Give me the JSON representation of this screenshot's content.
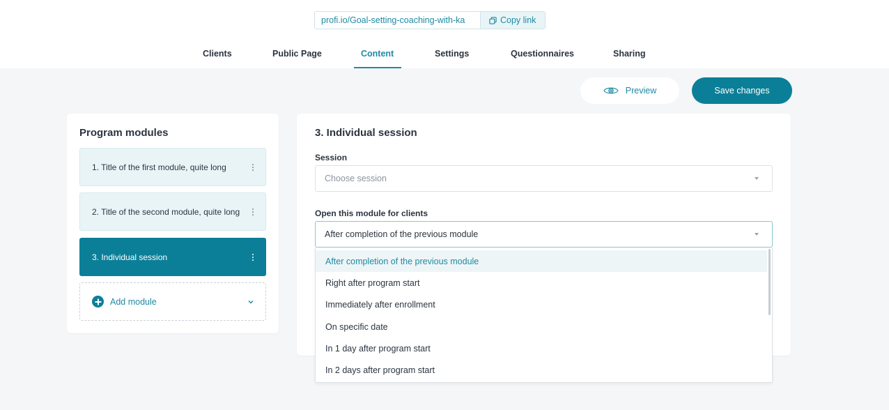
{
  "header": {
    "url": "profi.io/Goal-setting-coaching-with-ka",
    "copy_label": "Copy link",
    "tabs": [
      "Clients",
      "Public Page",
      "Content",
      "Settings",
      "Questionnaires",
      "Sharing"
    ],
    "active_tab": "Content"
  },
  "actions": {
    "preview_label": "Preview",
    "save_label": "Save changes"
  },
  "modules_panel": {
    "title": "Program modules",
    "modules": [
      "1. Title of the first module, quite long",
      "2. Title of the second module, quite long",
      "3. Individual session"
    ],
    "active_index": 2,
    "add_label": "Add module"
  },
  "detail": {
    "title": "3. Individual session",
    "session_label": "Session",
    "session_placeholder": "Choose session",
    "open_label": "Open this module for clients",
    "open_value": "After completion of the previous module",
    "options": [
      "After completion of the previous module",
      "Right after program start",
      "Immediately after enrollment",
      "On specific date",
      "In 1 day after program start",
      "In 2 days after program start"
    ]
  },
  "colors": {
    "accent": "#0c7f98",
    "accent_text": "#1f8aa3",
    "background": "#f4f6f8"
  }
}
